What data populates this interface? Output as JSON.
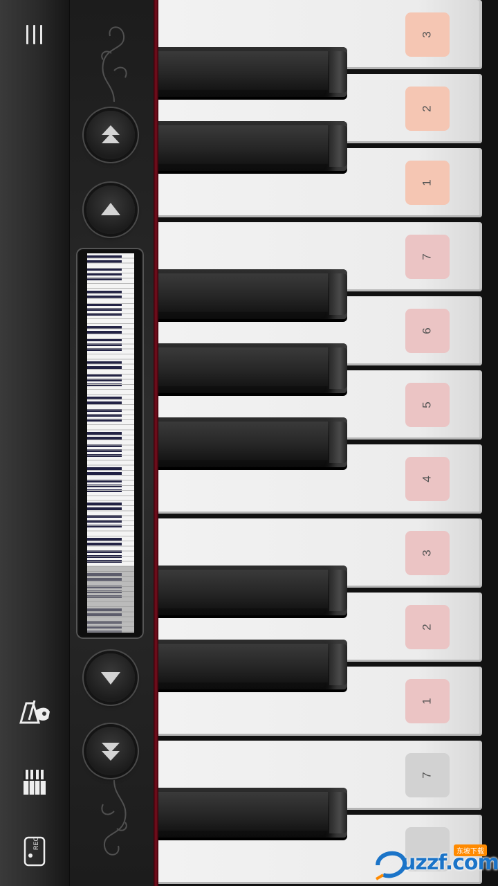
{
  "sidebar": {
    "menu_icon": "menu-bars-icon",
    "metronome_icon": "metronome-icon",
    "keyboard_icon": "keyboard-icon",
    "rec_label": "REC"
  },
  "controls": {
    "octave_up_icon": "double-triangle-up-icon",
    "key_up_icon": "triangle-up-icon",
    "key_down_icon": "triangle-down-icon",
    "octave_down_icon": "double-triangle-down-icon",
    "mini_keyboard_position": "visible range near bottom of mini keyboard"
  },
  "keys": {
    "white_keys": [
      {
        "label": "3",
        "badge_color": "#f5c6b3"
      },
      {
        "label": "2",
        "badge_color": "#f5c6b3"
      },
      {
        "label": "1",
        "badge_color": "#f5c6b3"
      },
      {
        "label": "7",
        "badge_color": "#ebc4c4"
      },
      {
        "label": "6",
        "badge_color": "#ebc4c4"
      },
      {
        "label": "5",
        "badge_color": "#ebc4c4"
      },
      {
        "label": "4",
        "badge_color": "#ebc4c4"
      },
      {
        "label": "3",
        "badge_color": "#ebc4c4"
      },
      {
        "label": "2",
        "badge_color": "#ebc4c4"
      },
      {
        "label": "1",
        "badge_color": "#ebc4c4"
      },
      {
        "label": "7",
        "badge_color": "#d2d2d2"
      },
      {
        "label": "",
        "badge_color": "#d2d2d2"
      }
    ]
  },
  "watermark": {
    "text": "uzzf.com",
    "tag": "东坡下载"
  },
  "colors": {
    "felt_red": "#7a1020",
    "accent_orange": "#f5c6b3",
    "accent_pink": "#ebc4c4",
    "accent_gray": "#d2d2d2"
  }
}
